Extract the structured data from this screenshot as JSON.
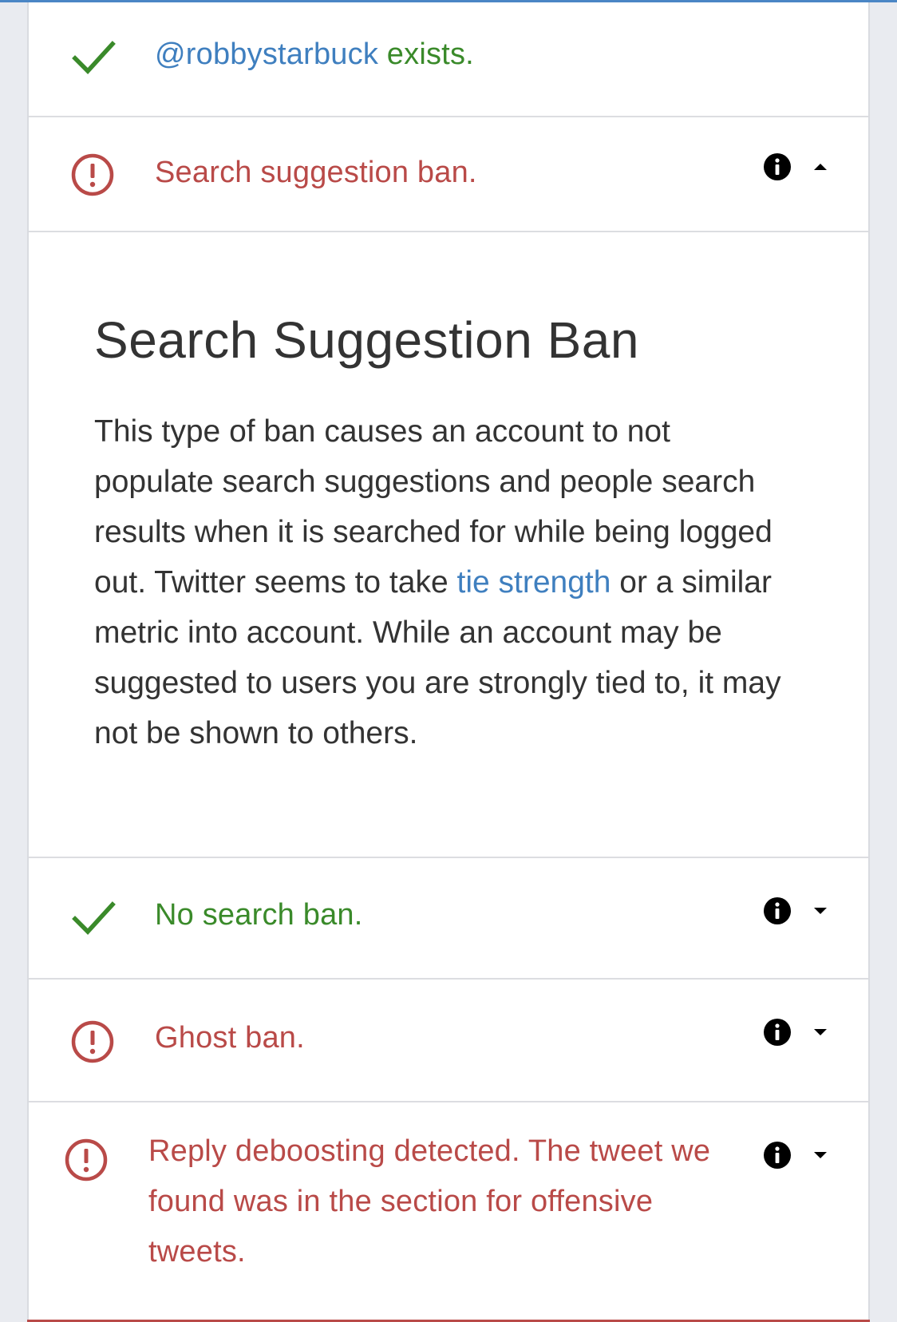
{
  "results": [
    {
      "id": "exists",
      "status": "ok",
      "icon": "checkmark-icon",
      "handle": "@robbystarbuck",
      "text": " exists."
    },
    {
      "id": "search-suggestion-ban",
      "status": "bad",
      "icon": "exclamation-circle-icon",
      "text": "Search suggestion ban.",
      "expanded": true
    },
    {
      "id": "search-ban",
      "status": "ok",
      "icon": "checkmark-icon",
      "text": "No search ban.",
      "expanded": false
    },
    {
      "id": "ghost-ban",
      "status": "bad",
      "icon": "exclamation-circle-icon",
      "text": "Ghost ban.",
      "expanded": false
    },
    {
      "id": "reply-deboosting",
      "status": "bad",
      "icon": "exclamation-circle-icon",
      "text": "Reply deboosting detected. The tweet we found was in the section for offensive tweets.",
      "expanded": false
    }
  ],
  "detail": {
    "title": "Search Suggestion Ban",
    "body_before_link": "This type of ban causes an account to not populate search suggestions and people search results when it is searched for while being logged out. Twitter seems to take ",
    "link_text": "tie strength",
    "body_after_link": " or a similar metric into account. While an account may be suggested to users you are strongly tied to, it may not be shown to others."
  },
  "icons": {
    "info": "info-icon",
    "chevron_up": "chevron-up-icon",
    "chevron_down": "chevron-down-icon"
  },
  "colors": {
    "ok": "#3a8a2a",
    "bad": "#b94a48",
    "link": "#3f7fbf",
    "text": "#333333",
    "page_background": "#e9ebf0",
    "top_accent": "#4a86c5"
  }
}
